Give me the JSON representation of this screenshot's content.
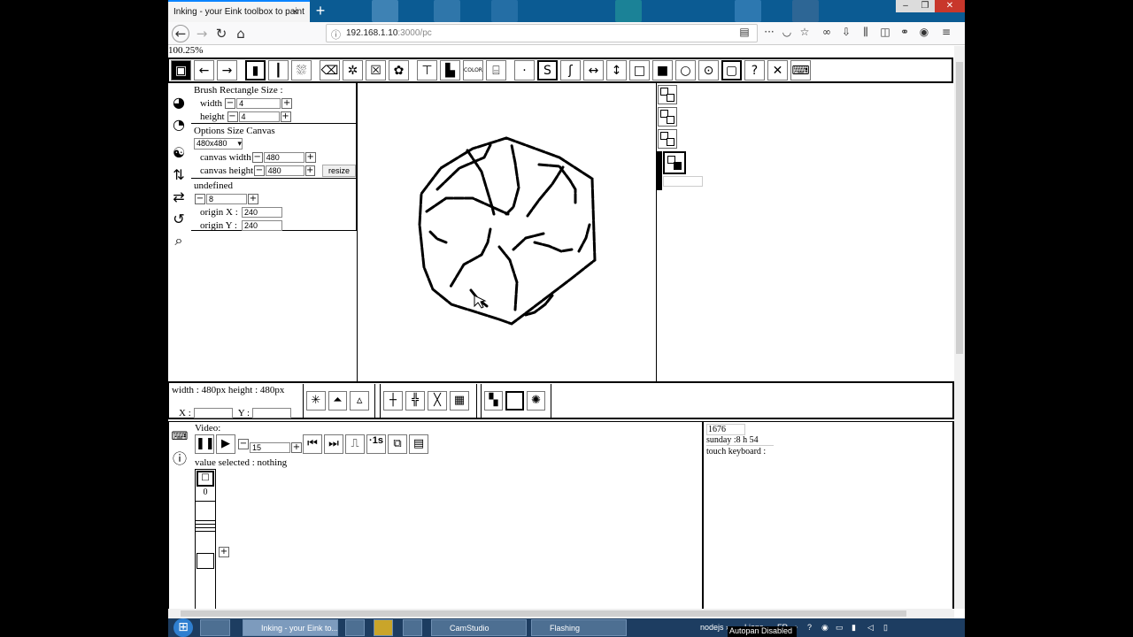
{
  "browser": {
    "tab_title": "Inking - your Eink toolbox to paint",
    "tab_close": "×",
    "new_tab": "+",
    "url_host": "192.168.1.10",
    "url_path": ":3000/pc",
    "zoom": "100.25%"
  },
  "left_panel": {
    "brush_title": "Brush Rectangle Size :",
    "width_label": "width",
    "width_value": "4",
    "height_label": "height",
    "height_value": "4",
    "options_title": "Options Size Canvas",
    "size_select": "480x480",
    "canvas_width_label": "canvas width",
    "canvas_width_value": "480",
    "canvas_height_label": "canvas height",
    "canvas_height_value": "480",
    "resize_label": "resize",
    "undefined_label": "undefined",
    "undefined_value": "8",
    "origin_x_label": "origin X :",
    "origin_x_value": "240",
    "origin_y_label": "origin Y :",
    "origin_y_value": "240"
  },
  "info_bar": {
    "dimensions": "width : 480px height : 480px",
    "x_label": "X :",
    "y_label": "Y :"
  },
  "lower": {
    "video_label": "Video:",
    "frame_value": "15",
    "one_sec": "·1s",
    "value_selected": "value selected : nothing",
    "stack_number": "0"
  },
  "right_panel": {
    "counter": "1676",
    "time": "sunday :8 h 54",
    "touch_keyboard": "touch keyboard :"
  },
  "taskbar": {
    "inking_task": "Inking - your Eink to...",
    "camstudio_task": "CamStudio",
    "flashing_task": "Flashing",
    "nodejs": "nodejs",
    "liens": "Liens",
    "lang": "FR",
    "autopan": "Autopan Disabled"
  },
  "colors": {
    "tabbar": "#0b5b93",
    "taskbar": "#1d3d61",
    "tab_accent": "#0a84ff"
  }
}
